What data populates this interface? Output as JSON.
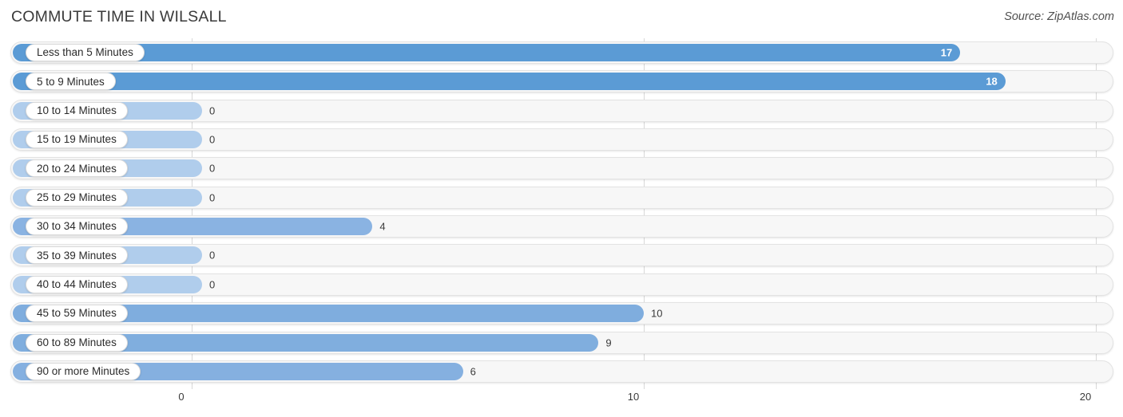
{
  "header": {
    "title": "COMMUTE TIME IN WILSALL",
    "source": "Source: ZipAtlas.com"
  },
  "chart_data": {
    "type": "bar",
    "orientation": "horizontal",
    "title": "COMMUTE TIME IN WILSALL",
    "xlabel": "",
    "ylabel": "",
    "xlim": [
      0,
      20
    ],
    "xticks": [
      0,
      10,
      20
    ],
    "xtick_labels": [
      "0",
      "10",
      "20"
    ],
    "grid": true,
    "legend": false,
    "bar_color": "#6aa3dc",
    "track_color": "#f7f7f7",
    "categories": [
      "Less than 5 Minutes",
      "5 to 9 Minutes",
      "10 to 14 Minutes",
      "15 to 19 Minutes",
      "20 to 24 Minutes",
      "25 to 29 Minutes",
      "30 to 34 Minutes",
      "35 to 39 Minutes",
      "40 to 44 Minutes",
      "45 to 59 Minutes",
      "60 to 89 Minutes",
      "90 or more Minutes"
    ],
    "values": [
      17,
      18,
      0,
      0,
      0,
      0,
      4,
      0,
      0,
      10,
      9,
      6
    ],
    "value_labels": [
      "17",
      "18",
      "0",
      "0",
      "0",
      "0",
      "4",
      "0",
      "0",
      "10",
      "9",
      "6"
    ]
  },
  "rows": [
    {
      "label": "Less than 5 Minutes",
      "value": 17,
      "value_label": "17",
      "color": "#5b9bd5",
      "inside": true
    },
    {
      "label": "5 to 9 Minutes",
      "value": 18,
      "value_label": "18",
      "color": "#5b9bd5",
      "inside": true
    },
    {
      "label": "10 to 14 Minutes",
      "value": 0,
      "value_label": "0",
      "color": "#b0cdec",
      "inside": false
    },
    {
      "label": "15 to 19 Minutes",
      "value": 0,
      "value_label": "0",
      "color": "#b0cdec",
      "inside": false
    },
    {
      "label": "20 to 24 Minutes",
      "value": 0,
      "value_label": "0",
      "color": "#b0cdec",
      "inside": false
    },
    {
      "label": "25 to 29 Minutes",
      "value": 0,
      "value_label": "0",
      "color": "#b0cdec",
      "inside": false
    },
    {
      "label": "30 to 34 Minutes",
      "value": 4,
      "value_label": "4",
      "color": "#8ab3e2",
      "inside": false
    },
    {
      "label": "35 to 39 Minutes",
      "value": 0,
      "value_label": "0",
      "color": "#b0cdec",
      "inside": false
    },
    {
      "label": "40 to 44 Minutes",
      "value": 0,
      "value_label": "0",
      "color": "#b0cdec",
      "inside": false
    },
    {
      "label": "45 to 59 Minutes",
      "value": 10,
      "value_label": "10",
      "color": "#7fadde",
      "inside": false
    },
    {
      "label": "60 to 89 Minutes",
      "value": 9,
      "value_label": "9",
      "color": "#80aede",
      "inside": false
    },
    {
      "label": "90 or more Minutes",
      "value": 6,
      "value_label": "6",
      "color": "#85b0e0",
      "inside": false
    }
  ],
  "axis": {
    "ticks": [
      {
        "label": "0",
        "value": 0
      },
      {
        "label": "10",
        "value": 10
      },
      {
        "label": "20",
        "value": 20
      }
    ]
  }
}
